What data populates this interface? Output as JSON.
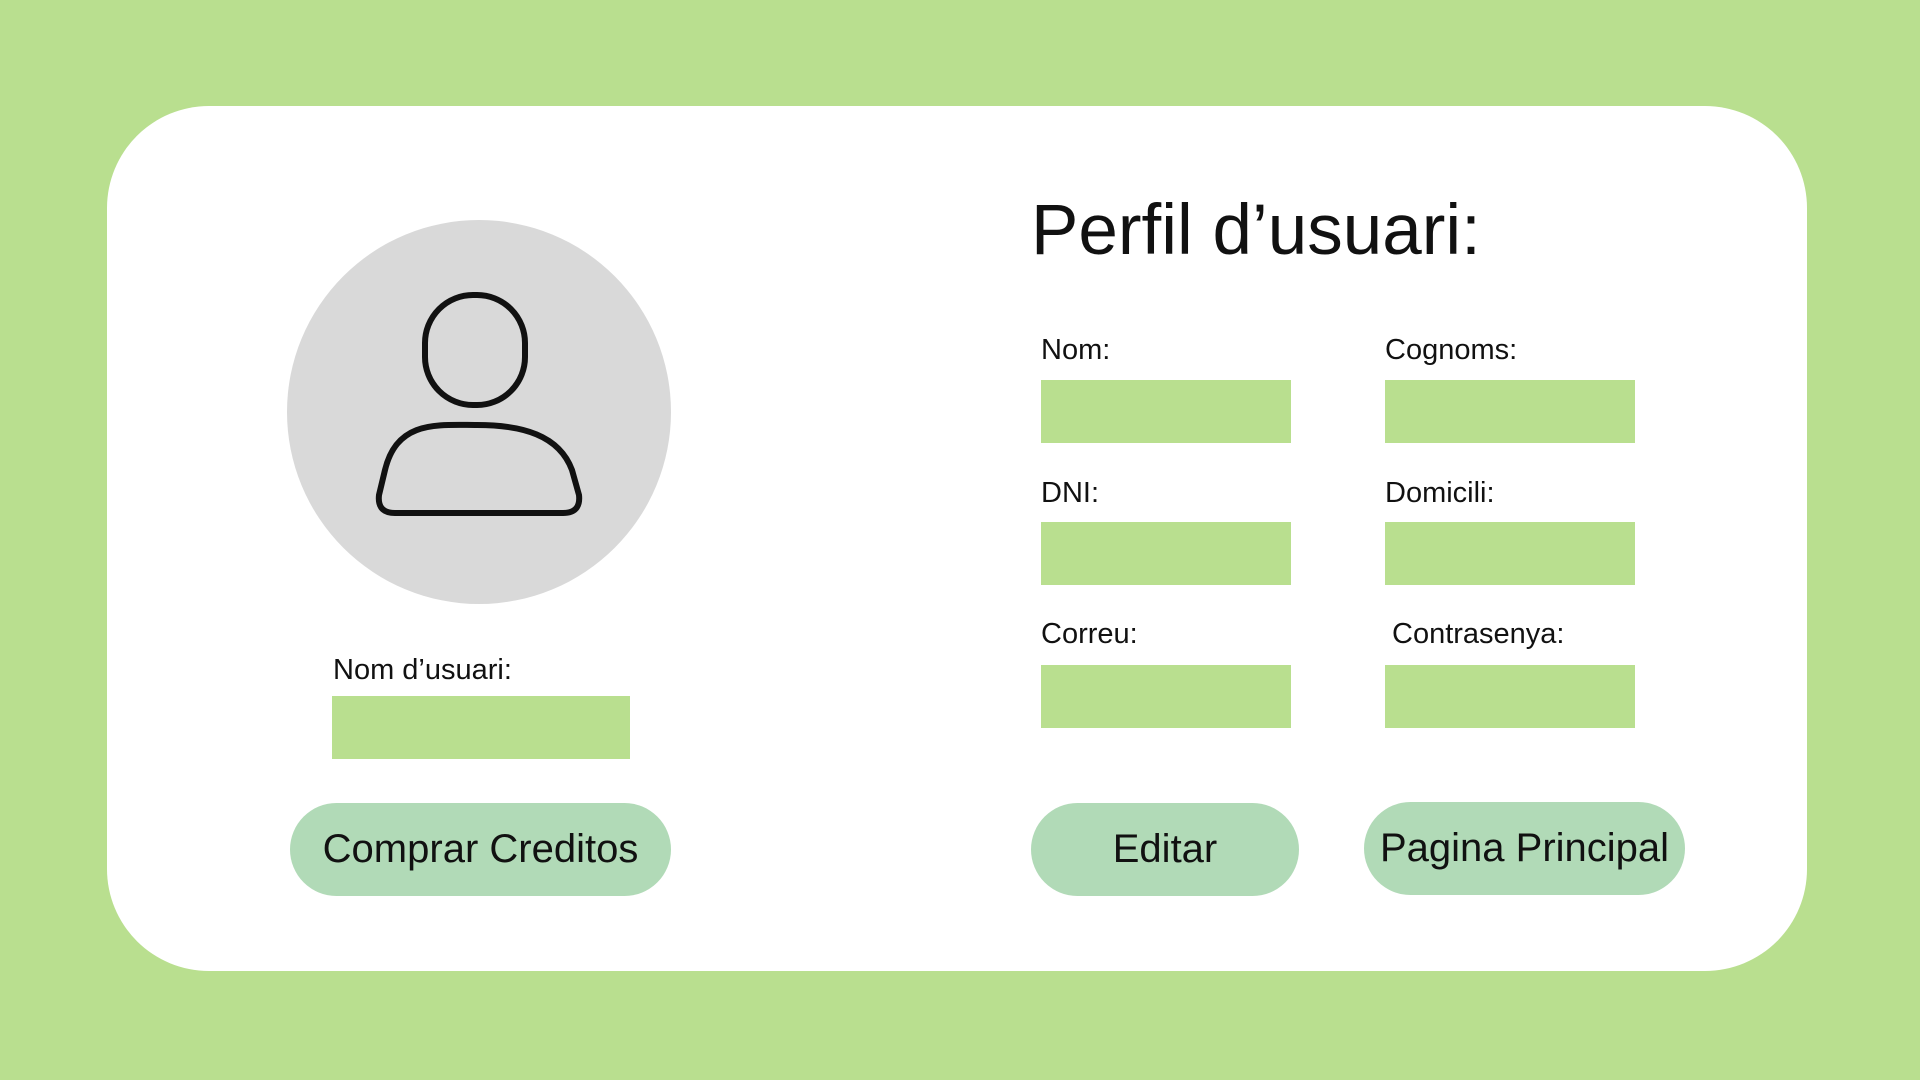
{
  "colors": {
    "background": "#b9df8f",
    "card": "#ffffff",
    "field": "#b9df8f",
    "button": "#b1dab7",
    "avatar": "#d9d9d9"
  },
  "icons": {
    "avatar": "user-icon"
  },
  "profile": {
    "title": "Perfil d’usuari:",
    "username_label": "Nom d’usuari:",
    "username_value": "",
    "fields": {
      "nom": {
        "label": "Nom:",
        "value": ""
      },
      "cognoms": {
        "label": "Cognoms:",
        "value": ""
      },
      "dni": {
        "label": "DNI:",
        "value": ""
      },
      "domicili": {
        "label": "Domicili:",
        "value": ""
      },
      "correu": {
        "label": "Correu:",
        "value": ""
      },
      "contrasenya": {
        "label": "Contrasenya:",
        "value": ""
      }
    }
  },
  "buttons": {
    "buy_credits": "Comprar Creditos",
    "edit": "Editar",
    "home": "Pagina Principal"
  }
}
